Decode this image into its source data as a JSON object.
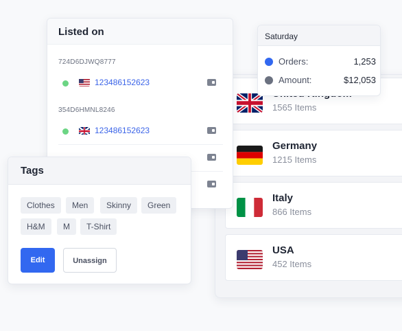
{
  "countries": [
    {
      "name": "United Kingdom",
      "items": "1565 Items",
      "flag": "uk-flag"
    },
    {
      "name": "Germany",
      "items": "1215 Items",
      "flag": "germany-flag"
    },
    {
      "name": "Italy",
      "items": "866 Items",
      "flag": "italy-flag"
    },
    {
      "name": "USA",
      "items": "452 Items",
      "flag": "usa-flag"
    }
  ],
  "listed": {
    "title": "Listed on",
    "groups": [
      {
        "sku": "724D6DJWQ8777",
        "rows": [
          {
            "id": "123486152623",
            "flag": "usa-flag",
            "status": "active"
          }
        ]
      },
      {
        "sku": "354D6HMNL8246",
        "rows": [
          {
            "id": "123486152623",
            "flag": "uk-flag",
            "status": "active"
          }
        ]
      }
    ]
  },
  "tooltip": {
    "day": "Saturday",
    "orders_label": "Orders:",
    "orders_value": "1,253",
    "amount_label": "Amount:",
    "amount_value": "$12,053",
    "orders_color": "#3268f0",
    "amount_color": "#6b7180"
  },
  "tags": {
    "title": "Tags",
    "chips": [
      "Clothes",
      "Men",
      "Skinny",
      "Green",
      "H&M",
      "M",
      "T-Shirt"
    ],
    "edit_label": "Edit",
    "unassign_label": "Unassign"
  }
}
